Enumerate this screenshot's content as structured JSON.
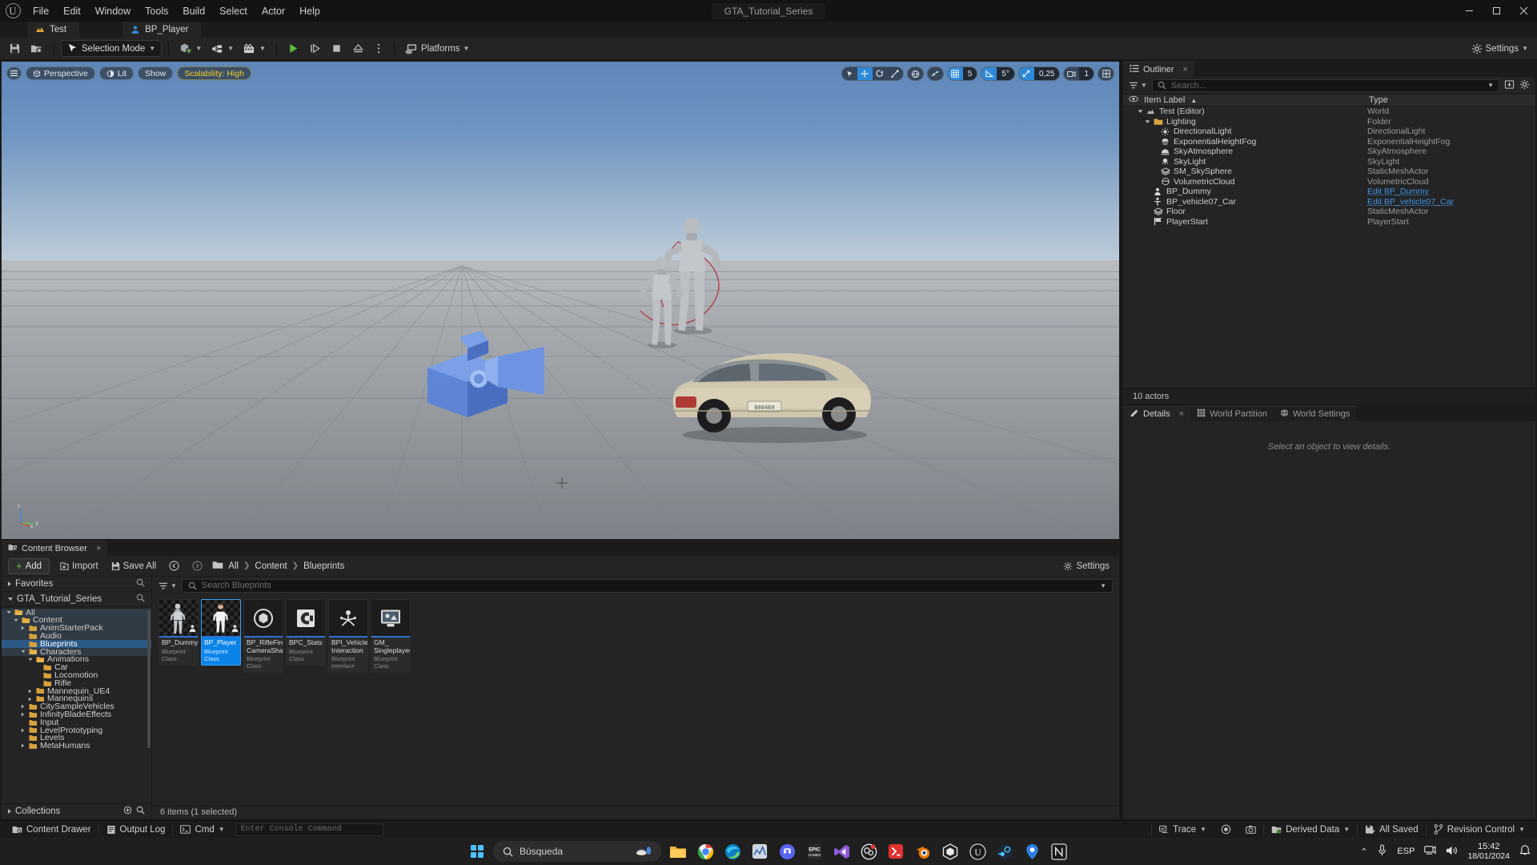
{
  "window": {
    "project_title": "GTA_Tutorial_Series",
    "minimize": "–",
    "maximize": "❐",
    "close": "✕"
  },
  "menu": {
    "items": [
      "File",
      "Edit",
      "Window",
      "Tools",
      "Build",
      "Select",
      "Actor",
      "Help"
    ]
  },
  "level_tabs": [
    {
      "label": "Test",
      "icon": "level-icon"
    },
    {
      "label": "BP_Player",
      "icon": "blueprint-icon"
    }
  ],
  "toolbar": {
    "save_icon": "save-icon",
    "browse_icon": "browse-icon",
    "mode_label": "Selection Mode",
    "create_icon": "add-actor-icon",
    "blueprint_icon": "blueprints-icon",
    "cinematics_icon": "cinematics-icon",
    "play_icon": "play-icon",
    "skip_icon": "skip-icon",
    "stop_icon": "stop-icon",
    "eject_icon": "eject-icon",
    "more_icon": "more-options-icon",
    "platforms_label": "Platforms",
    "settings_label": "Settings"
  },
  "viewport": {
    "menu_icon": "viewport-menu-icon",
    "perspective_label": "Perspective",
    "lit_label": "Lit",
    "show_label": "Show",
    "scalability_label": "Scalability: High",
    "grid_snap_value": "5",
    "angle_snap_value": "5°",
    "scale_snap_value": "0,25",
    "camera_speed_value": "1",
    "gizmo_axes": {
      "z": "z",
      "y": "y",
      "x": "x"
    },
    "tools": [
      "select-icon",
      "move-icon",
      "rotate-icon",
      "scale-icon",
      "world-coords-icon",
      "surface-snap-icon"
    ]
  },
  "outliner": {
    "tab_label": "Outliner",
    "tab_close": "×",
    "search_placeholder": "Search...",
    "filter_icon": "filter-icon",
    "save_icon": "save-outliner-icon",
    "settings_icon": "settings-icon",
    "col_item": "Item Label",
    "col_type": "Type",
    "sort_arrow": "▲",
    "footer": "10 actors",
    "rows": [
      {
        "label": "Test (Editor)",
        "type": "World",
        "indent": 1,
        "icon": "world-icon",
        "expander": "open",
        "link": false
      },
      {
        "label": "Lighting",
        "type": "Folder",
        "indent": 2,
        "icon": "folder-icon",
        "expander": "open",
        "link": false
      },
      {
        "label": "DirectionalLight",
        "type": "DirectionalLight",
        "indent": 3,
        "icon": "directional-light-icon",
        "expander": "none",
        "link": false
      },
      {
        "label": "ExponentialHeightFog",
        "type": "ExponentialHeightFog",
        "indent": 3,
        "icon": "fog-icon",
        "expander": "none",
        "link": false
      },
      {
        "label": "SkyAtmosphere",
        "type": "SkyAtmosphere",
        "indent": 3,
        "icon": "sky-atmosphere-icon",
        "expander": "none",
        "link": false
      },
      {
        "label": "SkyLight",
        "type": "SkyLight",
        "indent": 3,
        "icon": "sky-light-icon",
        "expander": "none",
        "link": false
      },
      {
        "label": "SM_SkySphere",
        "type": "StaticMeshActor",
        "indent": 3,
        "icon": "static-mesh-icon",
        "expander": "none",
        "link": false
      },
      {
        "label": "VolumetricCloud",
        "type": "VolumetricCloud",
        "indent": 3,
        "icon": "cloud-icon",
        "expander": "none",
        "link": false
      },
      {
        "label": "BP_Dummy",
        "type": "Edit BP_Dummy",
        "indent": 2,
        "icon": "character-icon",
        "expander": "none",
        "link": true
      },
      {
        "label": "BP_vehicle07_Car",
        "type": "Edit BP_vehicle07_Car",
        "indent": 2,
        "icon": "vehicle-icon",
        "expander": "none",
        "link": true
      },
      {
        "label": "Floor",
        "type": "StaticMeshActor",
        "indent": 2,
        "icon": "static-mesh-icon",
        "expander": "none",
        "link": false
      },
      {
        "label": "PlayerStart",
        "type": "PlayerStart",
        "indent": 2,
        "icon": "player-start-icon",
        "expander": "none",
        "link": false
      }
    ]
  },
  "details": {
    "tabs": [
      {
        "label": "Details",
        "icon": "details-icon",
        "active": true,
        "close": "×"
      },
      {
        "label": "World Partition",
        "icon": "world-partition-icon",
        "active": false
      },
      {
        "label": "World Settings",
        "icon": "world-settings-icon",
        "active": false
      }
    ],
    "empty_message": "Select an object to view details."
  },
  "content_browser": {
    "tab_label": "Content Browser",
    "tab_close": "×",
    "add_label": "Add",
    "import_label": "Import",
    "save_all_label": "Save All",
    "settings_label": "Settings",
    "breadcrumb": [
      "All",
      "Content",
      "Blueprints"
    ],
    "breadcrumb_sep": "❯",
    "search_placeholder": "Search Blueprints",
    "status": "6 items (1 selected)",
    "sources": {
      "favorites_label": "Favorites",
      "project_label": "GTA_Tutorial_Series",
      "collections_label": "Collections",
      "tree": [
        {
          "label": "All",
          "indent": 0,
          "state": "open",
          "highlight": true,
          "selected": false
        },
        {
          "label": "Content",
          "indent": 1,
          "state": "open",
          "highlight": true,
          "selected": false
        },
        {
          "label": "AnimStarterPack",
          "indent": 2,
          "state": "closed",
          "highlight": true,
          "selected": false
        },
        {
          "label": "Audio",
          "indent": 2,
          "state": "leaf",
          "highlight": true,
          "selected": false
        },
        {
          "label": "Blueprints",
          "indent": 2,
          "state": "leaf",
          "highlight": false,
          "selected": true
        },
        {
          "label": "Characters",
          "indent": 2,
          "state": "open",
          "highlight": true,
          "selected": false
        },
        {
          "label": "Animations",
          "indent": 3,
          "state": "open",
          "highlight": false,
          "selected": false
        },
        {
          "label": "Car",
          "indent": 4,
          "state": "leaf",
          "highlight": false,
          "selected": false
        },
        {
          "label": "Locomotion",
          "indent": 4,
          "state": "leaf",
          "highlight": false,
          "selected": false
        },
        {
          "label": "Rifle",
          "indent": 4,
          "state": "leaf",
          "highlight": false,
          "selected": false
        },
        {
          "label": "Mannequin_UE4",
          "indent": 3,
          "state": "closed",
          "highlight": false,
          "selected": false
        },
        {
          "label": "Mannequins",
          "indent": 3,
          "state": "closed",
          "highlight": false,
          "selected": false
        },
        {
          "label": "CitySampleVehicles",
          "indent": 2,
          "state": "closed",
          "highlight": false,
          "selected": false
        },
        {
          "label": "InfinityBladeEffects",
          "indent": 2,
          "state": "closed",
          "highlight": false,
          "selected": false
        },
        {
          "label": "Input",
          "indent": 2,
          "state": "leaf",
          "highlight": false,
          "selected": false
        },
        {
          "label": "LevelPrototyping",
          "indent": 2,
          "state": "closed",
          "highlight": false,
          "selected": false
        },
        {
          "label": "Levels",
          "indent": 2,
          "state": "leaf",
          "highlight": false,
          "selected": false
        },
        {
          "label": "MetaHumans",
          "indent": 2,
          "state": "closed",
          "highlight": false,
          "selected": false
        }
      ]
    },
    "assets": [
      {
        "name": "BP_Dummy",
        "type": "Blueprint Class",
        "thumb": "mannequin-grey",
        "selected": false
      },
      {
        "name": "BP_Player",
        "type": "Blueprint Class",
        "thumb": "mannequin-white",
        "selected": true
      },
      {
        "name": "BP_RifleFire CameraShake",
        "type": "Blueprint Class",
        "thumb": "camera-shake-icon",
        "selected": false
      },
      {
        "name": "BPC_Stats",
        "type": "Blueprint Class",
        "thumb": "component-icon",
        "selected": false
      },
      {
        "name": "BPI_Vehicle Interaction",
        "type": "Blueprint Interface",
        "thumb": "interface-icon",
        "selected": false
      },
      {
        "name": "GM_ Singleplayer",
        "type": "Blueprint Class",
        "thumb": "gamemode-icon",
        "selected": false
      }
    ]
  },
  "status_bar": {
    "content_drawer": "Content Drawer",
    "output_log": "Output Log",
    "cmd_label": "Cmd",
    "console_placeholder": "Enter Console Command",
    "trace_label": "Trace",
    "derived_data_label": "Derived Data",
    "all_saved_label": "All Saved",
    "revision_control_label": "Revision Control"
  },
  "taskbar": {
    "search_placeholder": "Búsqueda",
    "apps": [
      "file-explorer-icon",
      "chrome-icon",
      "edge-icon",
      "chart-app-icon",
      "discord-icon",
      "epic-games-icon",
      "visual-studio-icon",
      "substance-icon",
      "rider-icon",
      "blender-icon",
      "quixel-icon",
      "unreal-engine-icon",
      "steam-icon",
      "maps-icon",
      "notion-icon"
    ],
    "tray": {
      "chevron": "⌃",
      "mic": "mic-icon",
      "lang": "ESP",
      "network": "network-icon",
      "volume": "volume-icon",
      "time": "15:42",
      "date": "18/01/2024",
      "notifications": "notification-icon"
    }
  },
  "colors": {
    "accent_blue": "#0a84e8",
    "selection_blue": "#2c5a87",
    "link_blue": "#3d94e8",
    "scalability_yellow": "#f2d024",
    "add_green": "#6ec24a",
    "panel_bg": "#242424",
    "window_bg": "#1b1b1b"
  }
}
